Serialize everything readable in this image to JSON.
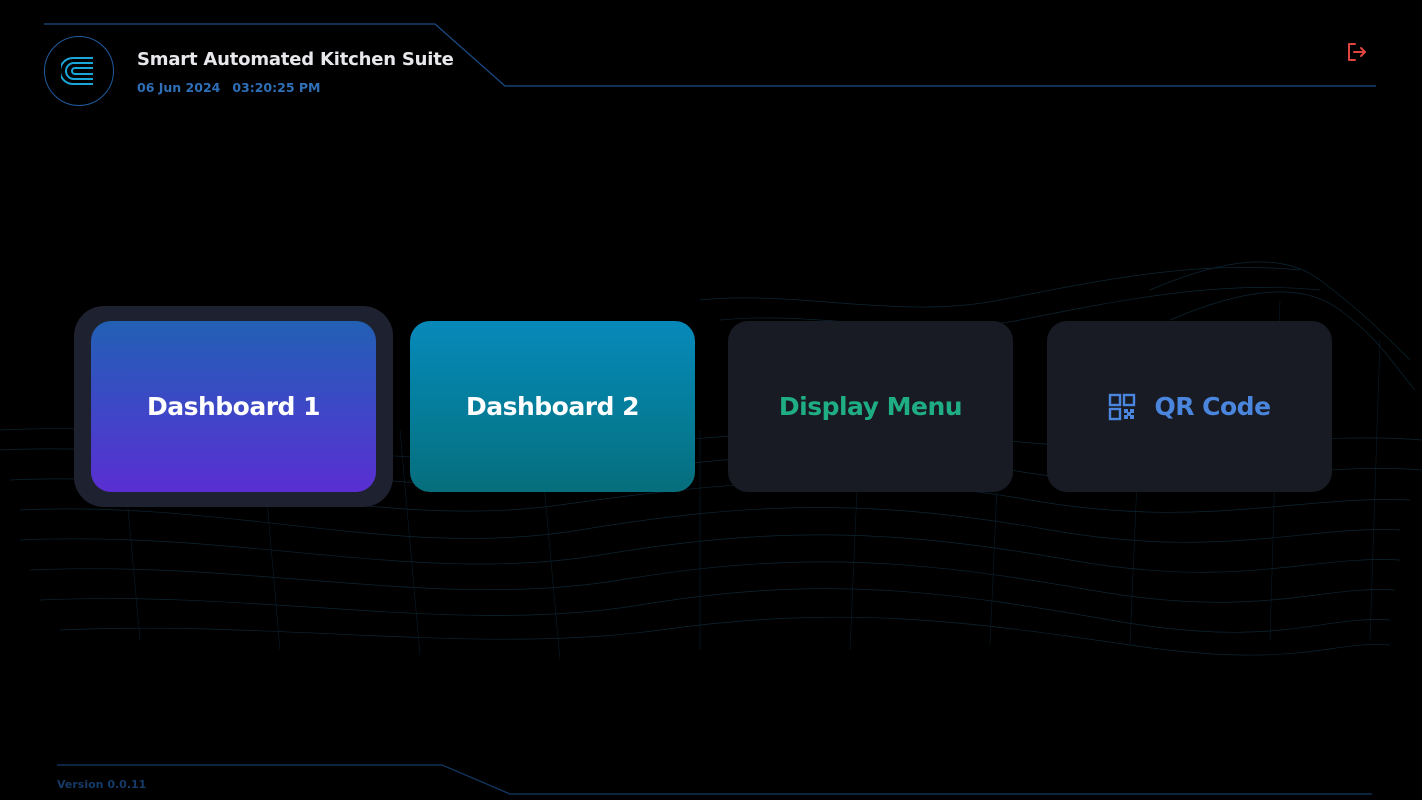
{
  "header": {
    "title": "Smart Automated Kitchen Suite",
    "date": "06 Jun 2024",
    "time": "03:20:25 PM",
    "logo_icon": "c-logo-icon",
    "logout_icon": "logout-icon"
  },
  "tiles": [
    {
      "label": "Dashboard 1",
      "selected": true
    },
    {
      "label": "Dashboard 2",
      "selected": false
    },
    {
      "label": "Display Menu",
      "selected": false
    },
    {
      "label": "QR Code",
      "icon": "qr-code-icon",
      "selected": false
    }
  ],
  "footer": {
    "version": "Version 0.0.11"
  },
  "colors": {
    "background": "#000000",
    "accent_blue": "#2f6fb8",
    "line_blue": "#1f5a9e",
    "display_menu_text": "#1fae84",
    "qr_code_text": "#4a86dd",
    "logout_red": "#e0443e"
  }
}
